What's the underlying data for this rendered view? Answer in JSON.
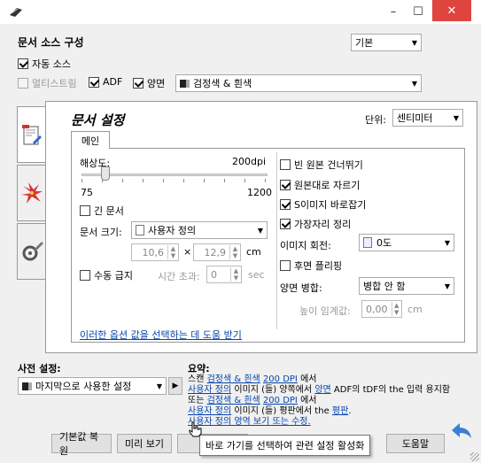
{
  "window": {
    "minimize": "–",
    "maximize": "☐",
    "close": "✕"
  },
  "scan_config": {
    "title": "문서 소스 구성",
    "preset_select": "기본",
    "auto_source": "자동 소스",
    "multistream": "멀티스트림",
    "adf": "ADF",
    "duplex": "양면",
    "color_mode": "검정색 & 흰색"
  },
  "doc_settings": {
    "title": "문서 설정",
    "unit_label": "단위:",
    "unit_value": "센티미터",
    "tab_main": "메인",
    "resolution_label": "해상도:",
    "resolution_value": "200dpi",
    "slider_min": "75",
    "slider_max": "1200",
    "resolution_fraction": 0.11,
    "long_doc": "긴 문서",
    "doc_size_label": "문서 크기:",
    "doc_size_value": "사용자 정의",
    "width_value": "10,6",
    "times": "×",
    "height_value": "12,9",
    "size_unit": "cm",
    "manual_feed": "수동 급지",
    "timeout_label": "시간 초과:",
    "timeout_value": "0",
    "timeout_unit": "sec",
    "skip_blank": "빈 원본 건너뛰기",
    "crop_original": "원본대로 자르기",
    "deskew": "S이미지 바로잡기",
    "edge_clean": "가장자리 정리",
    "rotate_label": "이미지 회전:",
    "rotate_value": "0도",
    "flip_back": "후면 플리핑",
    "merge_label": "양면 병합:",
    "merge_value": "병합 안 함",
    "height_threshold_label": "높이 임계값:",
    "height_threshold_value": "0,00",
    "height_threshold_unit": "cm",
    "help_link": "이러한 옵션 값을 선택하는 데 도움 받기"
  },
  "preset": {
    "label": "사전 설정:",
    "value": "마지막으로 사용한 설정"
  },
  "summary": {
    "label": "요약:",
    "l1_a": "스캔 ",
    "l1_link1": "검정색 & 흰색",
    "l1_link2": "200 DPI",
    "l1_b": " 에서",
    "l2_link1": "사용자 정의",
    "l2_a": " 이미지 (들) 양쪽에서 ",
    "l2_link2": "양면",
    "l2_b": " ADF의 tDF의 the 입력 용지함",
    "l3_a": " 또는 ",
    "l3_link1": "검정색 & 흰색",
    "l3_link2": "200 DPI",
    "l3_b": " 에서",
    "l4_link1": "사용자 정의",
    "l4_a": " 이미지 (들) 평판에서 the ",
    "l4_link2": "평판",
    "l4_b": ".",
    "l5_link": "사용자 정의 영역 보기 또는 수정."
  },
  "tooltip": "바로 가기를 선택하여 관련 설정 활성화",
  "buttons": {
    "reset": "기본값 복원",
    "preview": "미리 보기",
    "help": "도움말"
  }
}
